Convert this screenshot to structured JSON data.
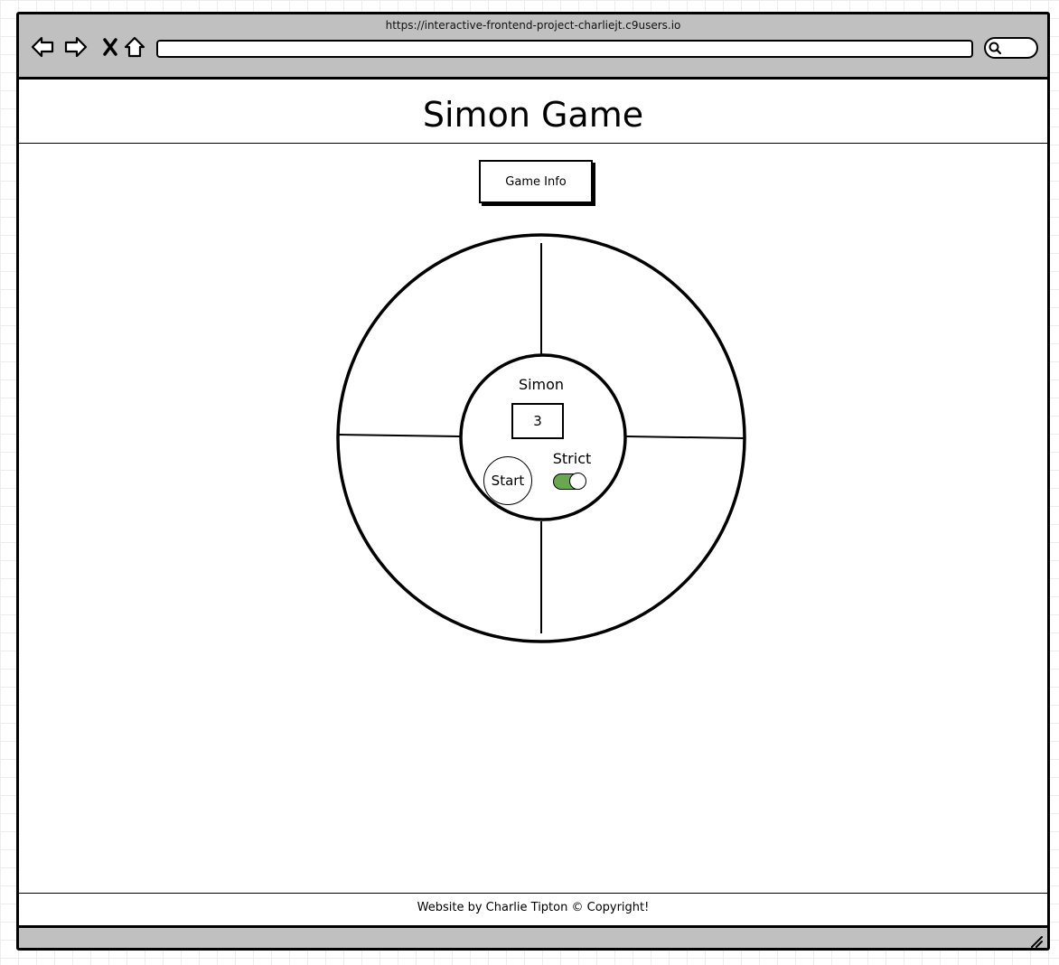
{
  "browser": {
    "url": "https://interactive-frontend-project-charliejt.c9users.io",
    "nav_icons": [
      "back-arrow-icon",
      "forward-arrow-icon",
      "close-icon",
      "home-icon"
    ],
    "search_icon": "search-icon",
    "resize_icon": "resize-grip-icon"
  },
  "page": {
    "title": "Simon Game",
    "info_button_label": "Game Info"
  },
  "game": {
    "center_label": "Simon",
    "count": "3",
    "start_label": "Start",
    "strict_label": "Strict",
    "strict_enabled": true,
    "quadrants": [
      "top-left",
      "top-right",
      "bottom-left",
      "bottom-right"
    ]
  },
  "footer": {
    "text": "Website by Charlie Tipton © Copyright!"
  },
  "colors": {
    "toggle_on": "#6aa84f",
    "chrome": "#c0c0c0",
    "grid": "#ececec"
  }
}
